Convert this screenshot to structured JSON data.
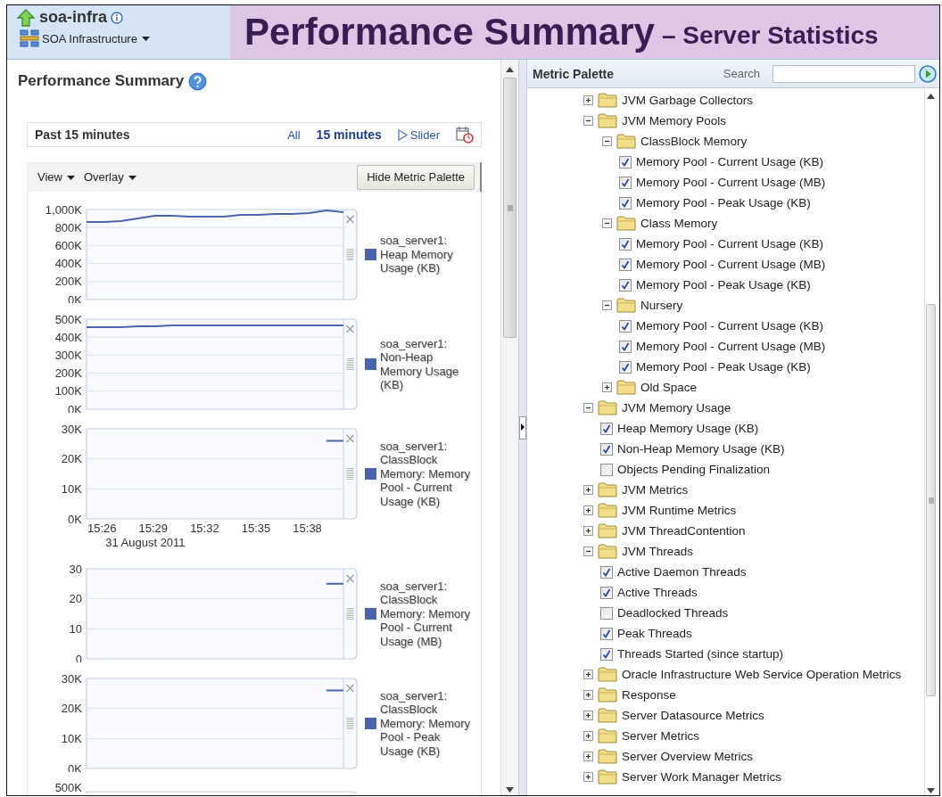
{
  "header": {
    "app_name": "soa-infra",
    "target_menu": "SOA Infrastructure",
    "title": "Performance Summary",
    "subtitle": "– Server Statistics"
  },
  "performance_summary": {
    "title": "Performance Summary",
    "time_range": {
      "label": "Past 15 minutes",
      "options": [
        {
          "label": "All",
          "selected": false
        },
        {
          "label": "15 minutes",
          "selected": true
        }
      ],
      "slider": "Slider"
    },
    "toolbar": {
      "menus": [
        "View",
        "Overlay"
      ],
      "button": "Hide Metric Palette"
    },
    "charts": [
      {
        "kind": "chart",
        "chart_data": {
          "type": "line",
          "grid": true,
          "categories": [
            null,
            null,
            null,
            null,
            null,
            null,
            null,
            null,
            null,
            null,
            null,
            null,
            null,
            null,
            null,
            null
          ],
          "ylim": [
            0,
            1000
          ],
          "yticks": [
            {
              "value": 0,
              "label": "0K"
            },
            {
              "value": 200,
              "label": "200K"
            },
            {
              "value": 400,
              "label": "400K"
            },
            {
              "value": 600,
              "label": "600K"
            },
            {
              "value": 800,
              "label": "800K"
            },
            {
              "value": 1000,
              "label": "1,000K"
            }
          ],
          "series": [
            {
              "name": "soa_server1: Heap Memory Usage (KB)",
              "color": "#4a63ad",
              "values": [
                860,
                860,
                870,
                900,
                930,
                930,
                920,
                920,
                920,
                940,
                940,
                950,
                950,
                960,
                990,
                970
              ]
            }
          ]
        }
      },
      {
        "kind": "chart",
        "chart_data": {
          "type": "line",
          "grid": true,
          "categories": [
            null,
            null,
            null,
            null,
            null,
            null,
            null,
            null,
            null,
            null,
            null,
            null,
            null,
            null,
            null,
            null
          ],
          "ylim": [
            0,
            500
          ],
          "yticks": [
            {
              "value": 0,
              "label": "0K"
            },
            {
              "value": 100,
              "label": "100K"
            },
            {
              "value": 200,
              "label": "200K"
            },
            {
              "value": 300,
              "label": "300K"
            },
            {
              "value": 400,
              "label": "400K"
            },
            {
              "value": 500,
              "label": "500K"
            }
          ],
          "series": [
            {
              "name": "soa_server1: Non-Heap Memory Usage (KB)",
              "color": "#4a63ad",
              "values": [
                455,
                455,
                455,
                460,
                460,
                465,
                465,
                465,
                465,
                465,
                465,
                465,
                465,
                465,
                465,
                465
              ]
            }
          ]
        }
      },
      {
        "kind": "chart",
        "chart_data": {
          "type": "line",
          "grid": true,
          "categories": [
            null,
            "15:26",
            null,
            null,
            "15:29",
            null,
            null,
            "15:32",
            null,
            null,
            "15:35",
            null,
            null,
            "15:38",
            null,
            null
          ],
          "xlabel": "31 August 2011",
          "ylim": [
            0,
            30
          ],
          "yticks": [
            {
              "value": 0,
              "label": "0K"
            },
            {
              "value": 10,
              "label": "10K"
            },
            {
              "value": 20,
              "label": "20K"
            },
            {
              "value": 30,
              "label": "30K"
            }
          ],
          "series": [
            {
              "name": "soa_server1: ClassBlock Memory: Memory Pool - Current Usage (KB)",
              "color": "#4a63ad",
              "values": [
                null,
                null,
                null,
                null,
                null,
                null,
                null,
                null,
                null,
                null,
                null,
                null,
                null,
                null,
                26,
                26
              ]
            }
          ]
        }
      },
      {
        "kind": "chart",
        "chart_data": {
          "type": "line",
          "grid": true,
          "categories": [
            null,
            null,
            null,
            null,
            null,
            null,
            null,
            null,
            null,
            null,
            null,
            null,
            null,
            null,
            null,
            null
          ],
          "ylim": [
            0,
            30
          ],
          "yticks": [
            {
              "value": 0,
              "label": "0"
            },
            {
              "value": 10,
              "label": "10"
            },
            {
              "value": 20,
              "label": "20"
            },
            {
              "value": 30,
              "label": "30"
            }
          ],
          "series": [
            {
              "name": "soa_server1: ClassBlock Memory: Memory Pool - Current Usage (MB)",
              "color": "#4a63ad",
              "values": [
                null,
                null,
                null,
                null,
                null,
                null,
                null,
                null,
                null,
                null,
                null,
                null,
                null,
                null,
                25,
                25
              ]
            }
          ]
        }
      },
      {
        "kind": "chart",
        "chart_data": {
          "type": "line",
          "grid": true,
          "categories": [
            null,
            null,
            null,
            null,
            null,
            null,
            null,
            null,
            null,
            null,
            null,
            null,
            null,
            null,
            null,
            null
          ],
          "ylim": [
            0,
            30
          ],
          "yticks": [
            {
              "value": 0,
              "label": "0K"
            },
            {
              "value": 10,
              "label": "10K"
            },
            {
              "value": 20,
              "label": "20K"
            },
            {
              "value": 30,
              "label": "30K"
            }
          ],
          "series": [
            {
              "name": "soa_server1: ClassBlock Memory: Memory Pool - Peak Usage (KB)",
              "color": "#4a63ad",
              "values": [
                null,
                null,
                null,
                null,
                null,
                null,
                null,
                null,
                null,
                null,
                null,
                null,
                null,
                null,
                26,
                26
              ]
            }
          ]
        }
      },
      {
        "kind": "partial",
        "tick": "500K"
      }
    ]
  },
  "metric_palette": {
    "title": "Metric Palette",
    "search_label": "Search",
    "tree": [
      {
        "kind": "folder",
        "label": "JVM Garbage Collectors",
        "expanded": false
      },
      {
        "kind": "folder",
        "label": "JVM Memory Pools",
        "expanded": true,
        "children": [
          {
            "kind": "folder",
            "label": "ClassBlock Memory",
            "expanded": true,
            "children": [
              {
                "kind": "metric",
                "label": "Memory Pool - Current Usage (KB)",
                "checked": true
              },
              {
                "kind": "metric",
                "label": "Memory Pool - Current Usage (MB)",
                "checked": true
              },
              {
                "kind": "metric",
                "label": "Memory Pool - Peak Usage (KB)",
                "checked": true
              }
            ]
          },
          {
            "kind": "folder",
            "label": "Class Memory",
            "expanded": true,
            "children": [
              {
                "kind": "metric",
                "label": "Memory Pool - Current Usage (KB)",
                "checked": true
              },
              {
                "kind": "metric",
                "label": "Memory Pool - Current Usage (MB)",
                "checked": true
              },
              {
                "kind": "metric",
                "label": "Memory Pool - Peak Usage (KB)",
                "checked": true
              }
            ]
          },
          {
            "kind": "folder",
            "label": "Nursery",
            "expanded": true,
            "children": [
              {
                "kind": "metric",
                "label": "Memory Pool - Current Usage (KB)",
                "checked": true
              },
              {
                "kind": "metric",
                "label": "Memory Pool - Current Usage (MB)",
                "checked": true
              },
              {
                "kind": "metric",
                "label": "Memory Pool - Peak Usage (KB)",
                "checked": true
              }
            ]
          },
          {
            "kind": "folder",
            "label": "Old Space",
            "expanded": false
          }
        ]
      },
      {
        "kind": "folder",
        "label": "JVM Memory Usage",
        "expanded": true,
        "children": [
          {
            "kind": "metric",
            "label": "Heap Memory Usage (KB)",
            "checked": true
          },
          {
            "kind": "metric",
            "label": "Non-Heap Memory Usage (KB)",
            "checked": true
          },
          {
            "kind": "metric",
            "label": "Objects Pending Finalization",
            "checked": false
          }
        ]
      },
      {
        "kind": "folder",
        "label": "JVM Metrics",
        "expanded": false
      },
      {
        "kind": "folder",
        "label": "JVM Runtime Metrics",
        "expanded": false
      },
      {
        "kind": "folder",
        "label": "JVM ThreadContention",
        "expanded": false
      },
      {
        "kind": "folder",
        "label": "JVM Threads",
        "expanded": true,
        "children": [
          {
            "kind": "metric",
            "label": "Active Daemon Threads",
            "checked": true
          },
          {
            "kind": "metric",
            "label": "Active Threads",
            "checked": true
          },
          {
            "kind": "metric",
            "label": "Deadlocked Threads",
            "checked": false
          },
          {
            "kind": "metric",
            "label": "Peak Threads",
            "checked": true
          },
          {
            "kind": "metric",
            "label": "Threads Started (since startup)",
            "checked": true
          }
        ]
      },
      {
        "kind": "folder",
        "label": "Oracle Infrastructure Web Service Operation Metrics",
        "expanded": false
      },
      {
        "kind": "folder",
        "label": "Response",
        "expanded": false
      },
      {
        "kind": "folder",
        "label": "Server Datasource Metrics",
        "expanded": false
      },
      {
        "kind": "folder",
        "label": "Server Metrics",
        "expanded": false
      },
      {
        "kind": "folder",
        "label": "Server Overview Metrics",
        "expanded": false
      },
      {
        "kind": "folder",
        "label": "Server Work Manager Metrics",
        "expanded": false
      }
    ]
  }
}
